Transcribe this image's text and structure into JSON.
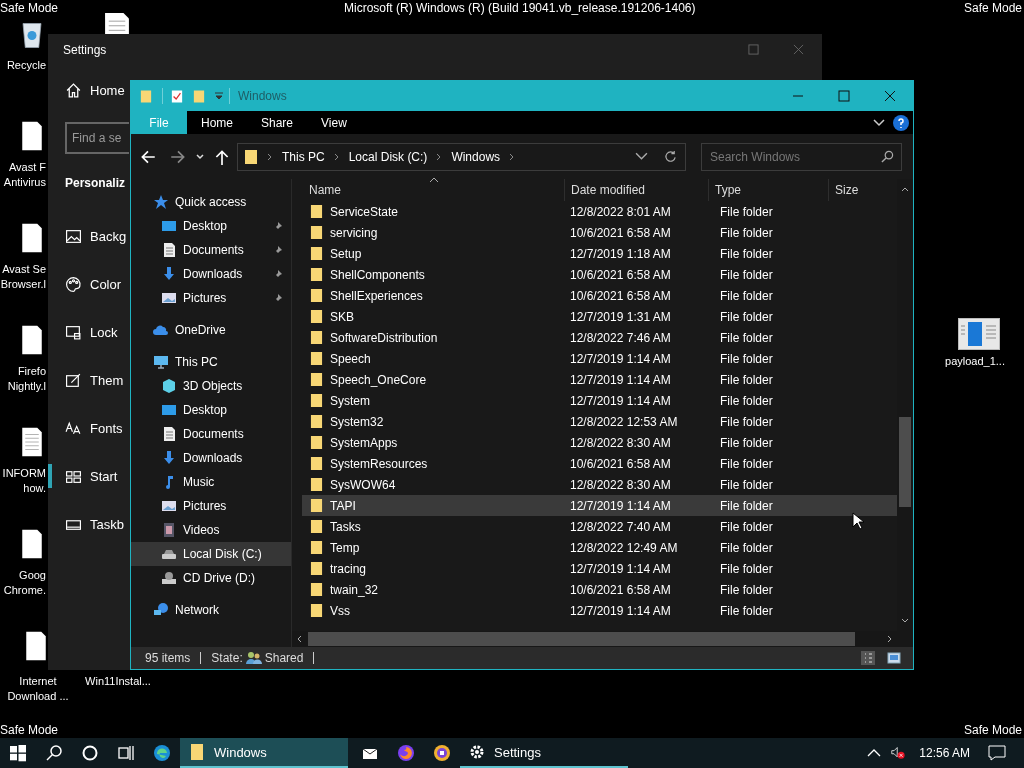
{
  "banner": {
    "top_left": "Safe Mode",
    "top_center": "Microsoft (R) Windows (R) (Build 19041.vb_release.191206-1406)",
    "top_right": "Safe Mode",
    "bottom_left": "Safe Mode",
    "bottom_right": "Safe Mode"
  },
  "desktop": {
    "left_column": [
      {
        "kind": "recycle",
        "lines": [
          "Recycle"
        ]
      },
      {
        "kind": "file",
        "lines": [
          "Avast F",
          "Antivirus"
        ]
      },
      {
        "kind": "file",
        "lines": [
          "Avast Se",
          "Browser.l"
        ]
      },
      {
        "kind": "file",
        "lines": [
          "Firefo",
          "Nightly.l"
        ]
      },
      {
        "kind": "document",
        "lines": [
          "INFORM",
          "how."
        ]
      },
      {
        "kind": "file",
        "lines": [
          "Goog",
          "Chrome."
        ]
      },
      {
        "kind": "file",
        "lines": [
          "Internet",
          "Download ..."
        ]
      }
    ],
    "second_column": [
      {
        "kind": "document"
      },
      {
        "kind": "none",
        "lines": [
          "Win11Instal..."
        ]
      }
    ],
    "right_column": [
      {
        "kind": "app",
        "lines": [
          "payload_1..."
        ]
      }
    ]
  },
  "settings": {
    "title": "Settings",
    "home": "Home",
    "search_placeholder": "Find a se",
    "section": "Personaliz",
    "nav": [
      {
        "kind": "background",
        "label": "Backg",
        "selected": false
      },
      {
        "kind": "colors",
        "label": "Color",
        "selected": false
      },
      {
        "kind": "lock",
        "label": "Lock",
        "selected": false
      },
      {
        "kind": "themes",
        "label": "Them",
        "selected": false
      },
      {
        "kind": "fonts",
        "label": "Fonts",
        "selected": false
      },
      {
        "kind": "start",
        "label": "Start",
        "selected": true
      },
      {
        "kind": "taskbar",
        "label": "Taskb",
        "selected": false
      }
    ]
  },
  "explorer": {
    "title": "Windows",
    "ribbon_tabs": [
      {
        "label": "File",
        "selected": true
      },
      {
        "label": "Home",
        "selected": false
      },
      {
        "label": "Share",
        "selected": false
      },
      {
        "label": "View",
        "selected": false
      }
    ],
    "breadcrumb": [
      "This PC",
      "Local Disk (C:)",
      "Windows"
    ],
    "search": {
      "placeholder": "Search Windows"
    },
    "nav": [
      {
        "kind": "star",
        "label": "Quick access",
        "selected": false,
        "children": [
          {
            "kind": "desktop",
            "label": "Desktop",
            "selected": false,
            "pinned": true
          },
          {
            "kind": "documents",
            "label": "Documents",
            "selected": false,
            "pinned": true
          },
          {
            "kind": "downloads",
            "label": "Downloads",
            "selected": false,
            "pinned": true
          },
          {
            "kind": "pictures",
            "label": "Pictures",
            "selected": false,
            "pinned": true
          }
        ]
      },
      {
        "kind": "cloud",
        "label": "OneDrive",
        "selected": false
      },
      {
        "kind": "pc",
        "label": "This PC",
        "selected": false,
        "children": [
          {
            "kind": "cube",
            "label": "3D Objects",
            "selected": false,
            "pinned": false
          },
          {
            "kind": "desktop",
            "label": "Desktop",
            "selected": false,
            "pinned": false
          },
          {
            "kind": "documents",
            "label": "Documents",
            "selected": false,
            "pinned": false
          },
          {
            "kind": "downloads",
            "label": "Downloads",
            "selected": false,
            "pinned": false
          },
          {
            "kind": "music",
            "label": "Music",
            "selected": false,
            "pinned": false
          },
          {
            "kind": "pictures",
            "label": "Pictures",
            "selected": false,
            "pinned": false
          },
          {
            "kind": "videos",
            "label": "Videos",
            "selected": false,
            "pinned": false
          },
          {
            "kind": "drive",
            "label": "Local Disk (C:)",
            "selected": true,
            "pinned": false
          },
          {
            "kind": "cd",
            "label": "CD Drive (D:)",
            "selected": false,
            "pinned": false
          }
        ]
      },
      {
        "kind": "network",
        "label": "Network",
        "selected": false
      }
    ],
    "columns": [
      "Name",
      "Date modified",
      "Type",
      "Size"
    ],
    "rows": [
      {
        "name": "ServiceState",
        "date": "12/8/2022 8:01 AM",
        "type": "File folder",
        "selected": false
      },
      {
        "name": "servicing",
        "date": "10/6/2021 6:58 AM",
        "type": "File folder",
        "selected": false
      },
      {
        "name": "Setup",
        "date": "12/7/2019 1:18 AM",
        "type": "File folder",
        "selected": false
      },
      {
        "name": "ShellComponents",
        "date": "10/6/2021 6:58 AM",
        "type": "File folder",
        "selected": false
      },
      {
        "name": "ShellExperiences",
        "date": "10/6/2021 6:58 AM",
        "type": "File folder",
        "selected": false
      },
      {
        "name": "SKB",
        "date": "12/7/2019 1:31 AM",
        "type": "File folder",
        "selected": false
      },
      {
        "name": "SoftwareDistribution",
        "date": "12/8/2022 7:46 AM",
        "type": "File folder",
        "selected": false
      },
      {
        "name": "Speech",
        "date": "12/7/2019 1:14 AM",
        "type": "File folder",
        "selected": false
      },
      {
        "name": "Speech_OneCore",
        "date": "12/7/2019 1:14 AM",
        "type": "File folder",
        "selected": false
      },
      {
        "name": "System",
        "date": "12/7/2019 1:14 AM",
        "type": "File folder",
        "selected": false
      },
      {
        "name": "System32",
        "date": "12/8/2022 12:53 AM",
        "type": "File folder",
        "selected": false
      },
      {
        "name": "SystemApps",
        "date": "12/8/2022 8:30 AM",
        "type": "File folder",
        "selected": false
      },
      {
        "name": "SystemResources",
        "date": "10/6/2021 6:58 AM",
        "type": "File folder",
        "selected": false
      },
      {
        "name": "SysWOW64",
        "date": "12/8/2022 8:30 AM",
        "type": "File folder",
        "selected": false
      },
      {
        "name": "TAPI",
        "date": "12/7/2019 1:14 AM",
        "type": "File folder",
        "selected": true
      },
      {
        "name": "Tasks",
        "date": "12/8/2022 7:40 AM",
        "type": "File folder",
        "selected": false
      },
      {
        "name": "Temp",
        "date": "12/8/2022 12:49 AM",
        "type": "File folder",
        "selected": false
      },
      {
        "name": "tracing",
        "date": "12/7/2019 1:14 AM",
        "type": "File folder",
        "selected": false
      },
      {
        "name": "twain_32",
        "date": "10/6/2021 6:58 AM",
        "type": "File folder",
        "selected": false
      },
      {
        "name": "Vss",
        "date": "12/7/2019 1:14 AM",
        "type": "File folder",
        "selected": false
      }
    ],
    "status": {
      "count": "95 items",
      "state_label": "State:",
      "state_value": "Shared"
    }
  },
  "taskbar": {
    "items": [
      {
        "kind": "start",
        "selected": false,
        "open": false
      },
      {
        "kind": "search",
        "selected": false,
        "open": false
      },
      {
        "kind": "cortana",
        "selected": false,
        "open": false
      },
      {
        "kind": "taskview",
        "selected": false,
        "open": false
      },
      {
        "kind": "edge",
        "selected": false,
        "open": false
      },
      {
        "kind": "folder",
        "label": "Windows",
        "selected": true,
        "open": true
      },
      {
        "kind": "mail",
        "selected": false,
        "open": false
      },
      {
        "kind": "firefox",
        "selected": false,
        "open": false
      },
      {
        "kind": "browser",
        "selected": false,
        "open": false
      },
      {
        "kind": "gear",
        "label": "Settings",
        "selected": false,
        "open": true
      }
    ],
    "muted": true,
    "clock": "12:56 AM"
  }
}
